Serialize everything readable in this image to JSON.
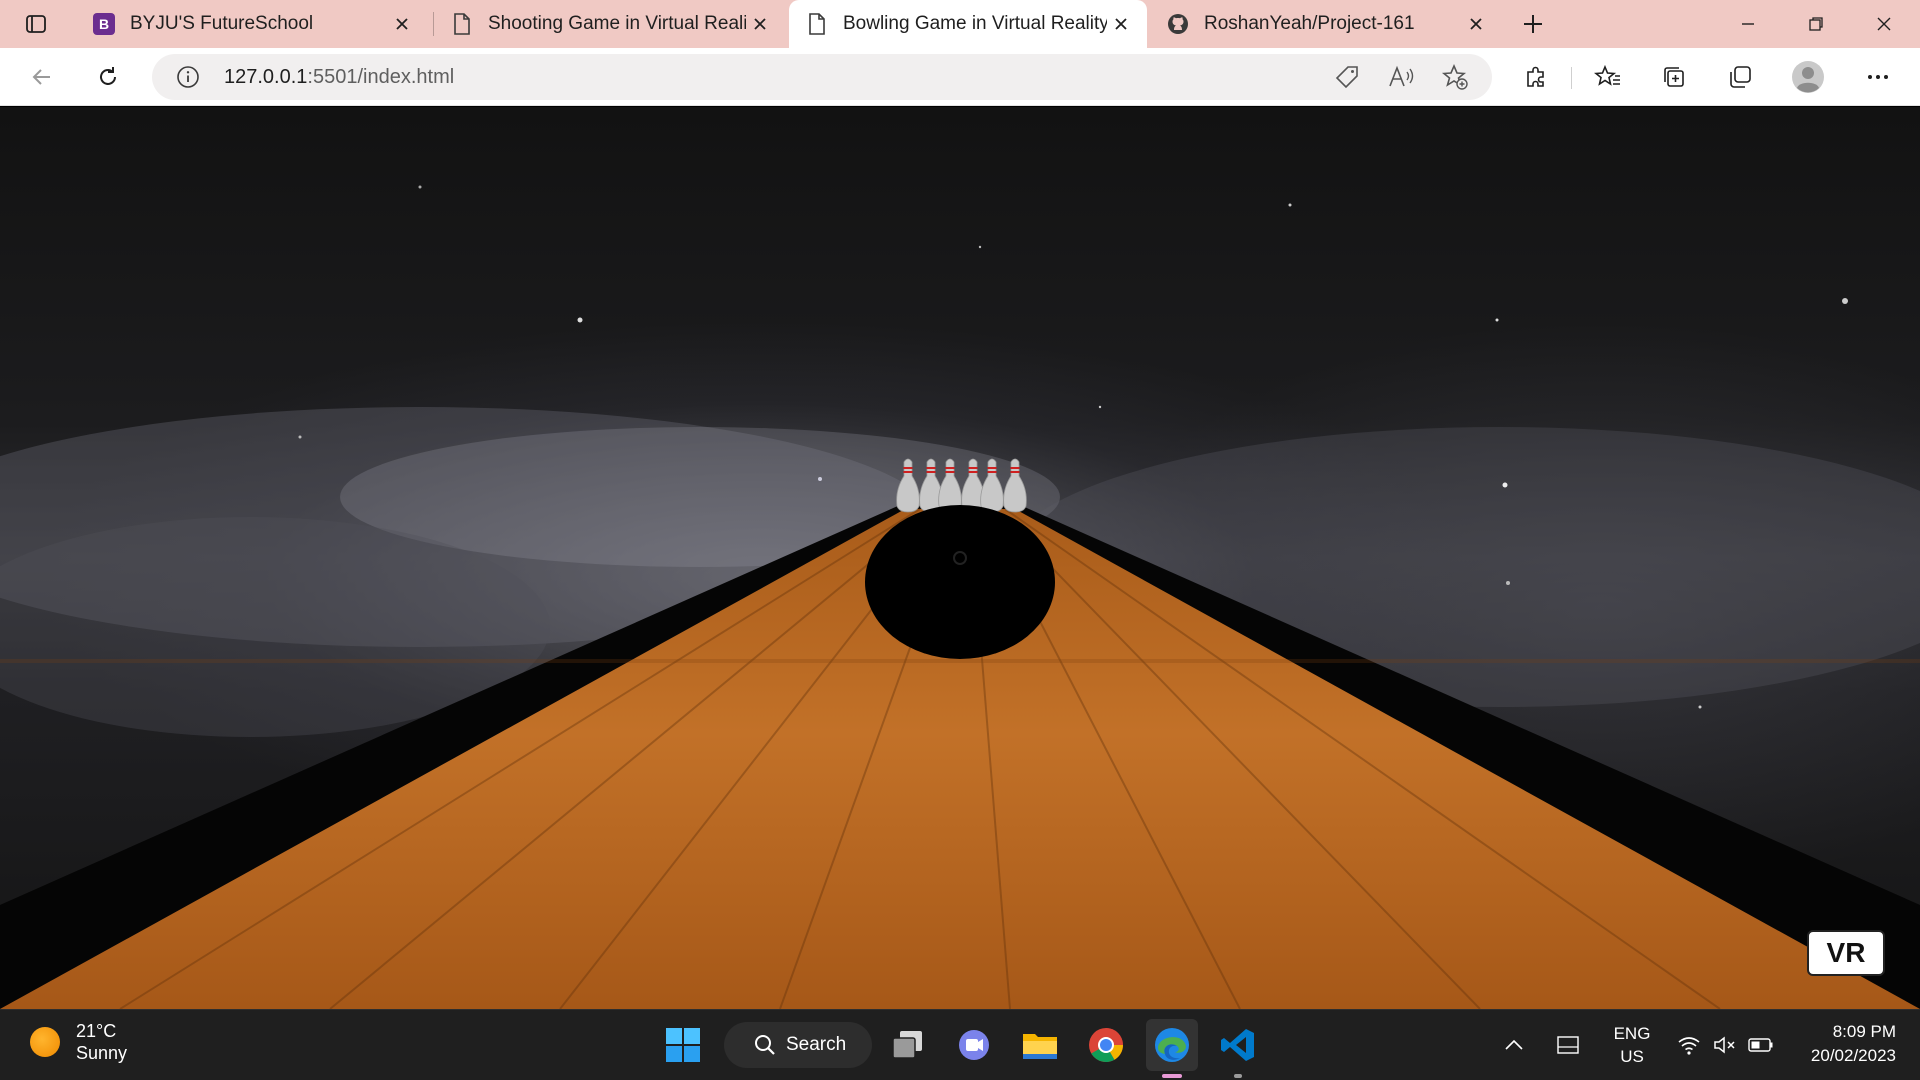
{
  "browser": {
    "tabs": [
      {
        "label": "BYJU'S FutureSchool",
        "favicon": "byjus-logo-icon"
      },
      {
        "label": "Shooting Game in Virtual Reality",
        "favicon": "page-icon"
      },
      {
        "label": "Bowling Game in Virtual Reality",
        "favicon": "page-icon",
        "active": true
      },
      {
        "label": "RoshanYeah/Project-161",
        "favicon": "github-icon"
      }
    ],
    "address": {
      "host": "127.0.0.1",
      "path": ":5501/index.html"
    }
  },
  "scene": {
    "vr_button_label": "VR",
    "lane_color": "#b8691f",
    "ball_color": "#000000",
    "pin_count": 6
  },
  "taskbar": {
    "weather": {
      "temp": "21°C",
      "condition": "Sunny"
    },
    "search_label": "Search",
    "language": {
      "line1": "ENG",
      "line2": "US"
    },
    "clock": {
      "time": "8:09 PM",
      "date": "20/02/2023"
    }
  }
}
